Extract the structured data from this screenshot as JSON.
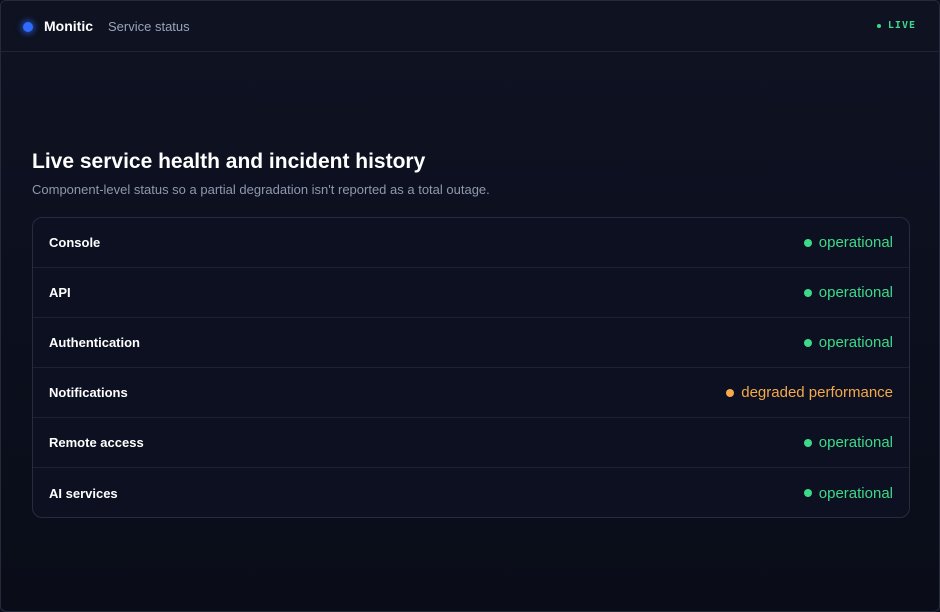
{
  "header": {
    "brand": "Monitic",
    "subtitle": "Service status",
    "live_label": "LIVE"
  },
  "main": {
    "title": "Live service health and incident history",
    "description": "Component-level status so a partial degradation isn't reported as a total outage."
  },
  "components": [
    {
      "name": "Console",
      "status": "operational",
      "level": "ok"
    },
    {
      "name": "API",
      "status": "operational",
      "level": "ok"
    },
    {
      "name": "Authentication",
      "status": "operational",
      "level": "ok"
    },
    {
      "name": "Notifications",
      "status": "degraded performance",
      "level": "warn"
    },
    {
      "name": "Remote access",
      "status": "operational",
      "level": "ok"
    },
    {
      "name": "AI services",
      "status": "operational",
      "level": "ok"
    }
  ],
  "colors": {
    "brand_accent": "#2f6bff",
    "operational": "#3ed88a",
    "degraded": "#f5a94a"
  }
}
